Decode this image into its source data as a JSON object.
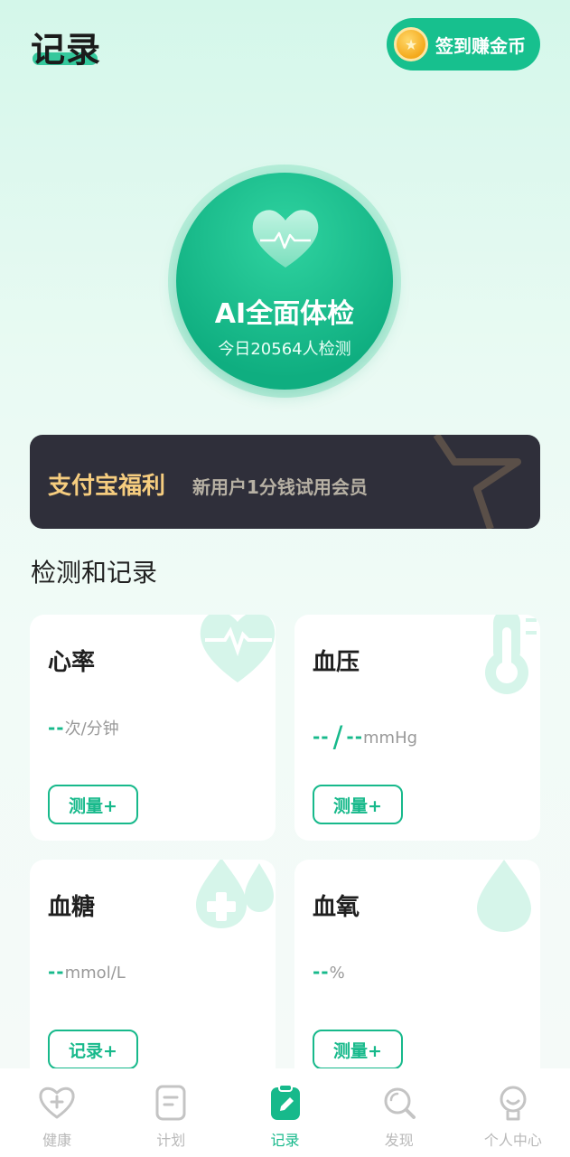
{
  "header": {
    "title": "记录",
    "checkin_label": "签到赚金币"
  },
  "ai_check": {
    "title": "AI全面体检",
    "subtitle": "今日20564人检测"
  },
  "promo": {
    "title": "支付宝福利",
    "subtitle": "新用户1分钱试用会员"
  },
  "section": {
    "title": "检测和记录"
  },
  "cards": [
    {
      "name": "心率",
      "dash": "--",
      "unit": "次/分钟",
      "button": "测量+"
    },
    {
      "name": "血压",
      "dash1": "--",
      "slash": "/",
      "dash2": "--",
      "unit": "mmHg",
      "button": "测量+"
    },
    {
      "name": "血糖",
      "dash": "--",
      "unit": "mmol/L",
      "button": "记录+"
    },
    {
      "name": "血氧",
      "dash": "--",
      "unit": "%",
      "button": "测量+"
    }
  ],
  "tabs": [
    {
      "label": "健康",
      "icon": "heart-plus-icon"
    },
    {
      "label": "计划",
      "icon": "plan-doc-icon"
    },
    {
      "label": "记录",
      "icon": "record-clipboard-icon",
      "active": true
    },
    {
      "label": "发现",
      "icon": "search-icon"
    },
    {
      "label": "个人中心",
      "icon": "user-icon"
    }
  ],
  "colors": {
    "accent": "#17b98b",
    "promo_bg": "#2f2f3a",
    "promo_gold": "#f6cd7f"
  }
}
